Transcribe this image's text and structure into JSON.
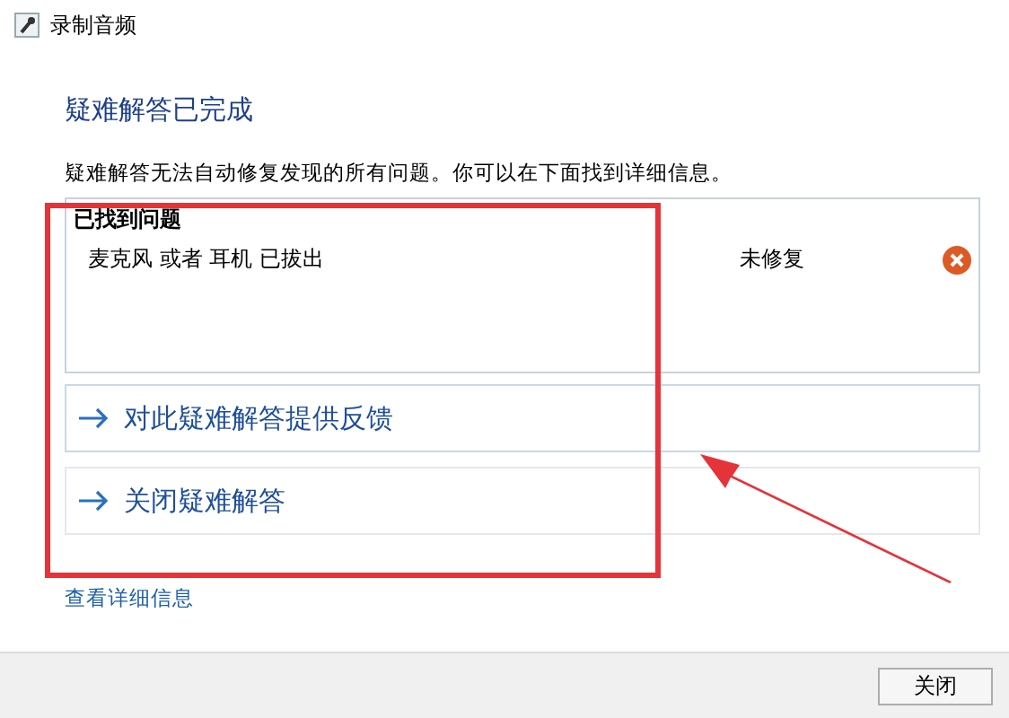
{
  "window": {
    "title": "录制音频"
  },
  "heading": "疑难解答已完成",
  "description": "疑难解答无法自动修复发现的所有问题。你可以在下面找到详细信息。",
  "issues_panel": {
    "title": "已找到问题",
    "issues": [
      {
        "name": "麦克风 或者 耳机 已拔出",
        "status": "未修复",
        "fixed": false
      }
    ]
  },
  "actions": [
    {
      "label": "对此疑难解答提供反馈"
    },
    {
      "label": "关闭疑难解答"
    }
  ],
  "details_link": "查看详细信息",
  "buttons": [
    "关闭"
  ]
}
